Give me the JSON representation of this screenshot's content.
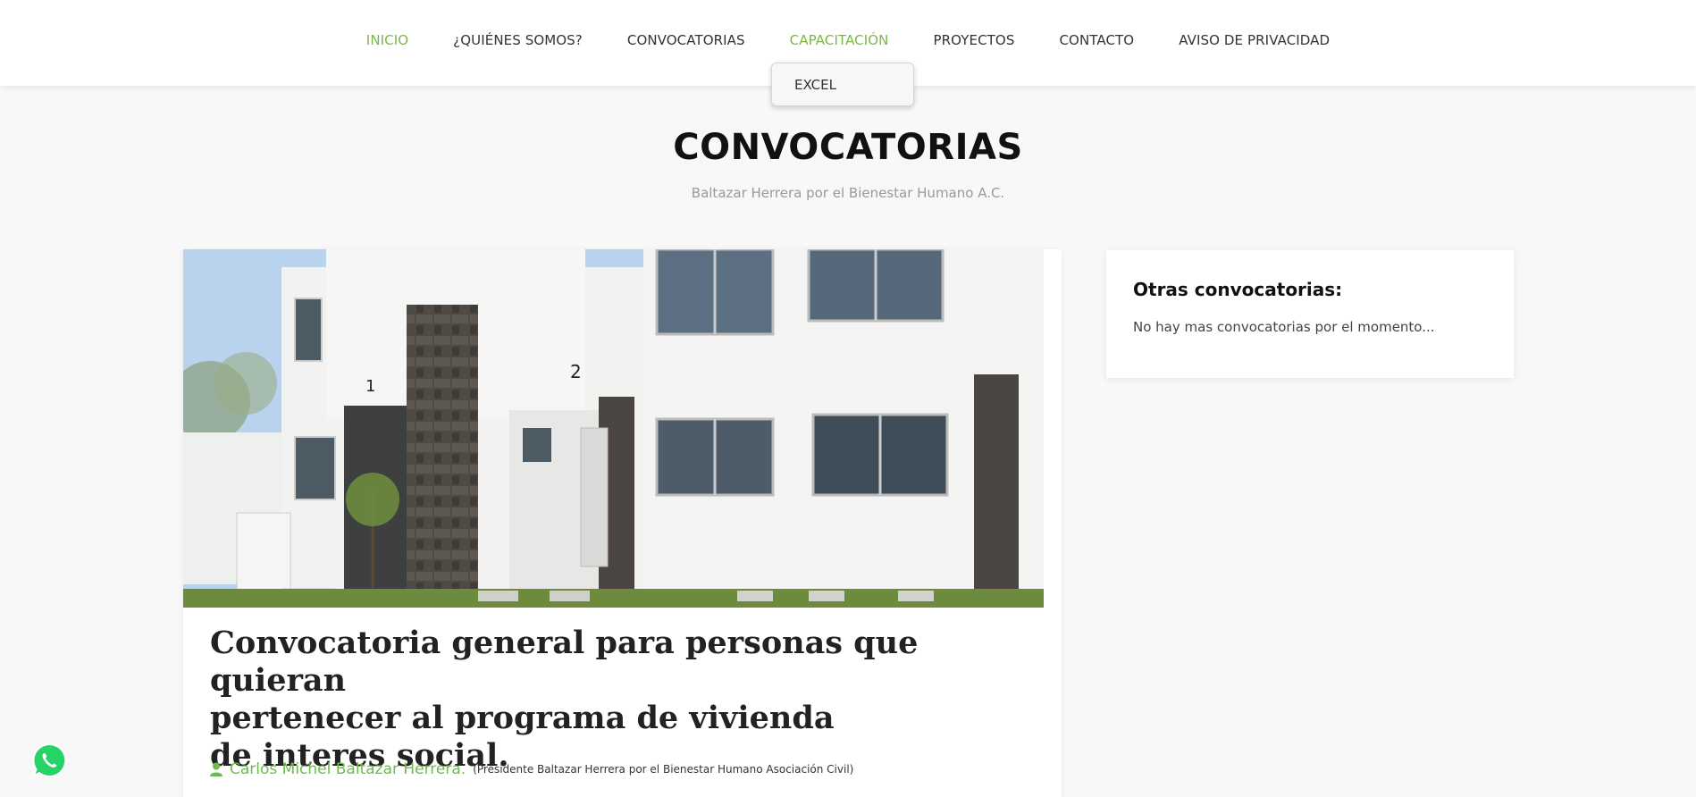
{
  "nav": {
    "items": [
      {
        "label": "INICIO"
      },
      {
        "label": "¿QUIÉNES SOMOS?"
      },
      {
        "label": "CONVOCATORIAS"
      },
      {
        "label": "CAPACITACIÓN"
      },
      {
        "label": "PROYECTOS"
      },
      {
        "label": "CONTACTO"
      },
      {
        "label": "AVISO DE PRIVACIDAD"
      }
    ],
    "dropdown": {
      "items": [
        {
          "label": "EXCEL"
        }
      ]
    }
  },
  "header": {
    "title": "CONVOCATORIAS",
    "subtitle": "Baltazar Herrera por el Bienestar Humano A.C."
  },
  "post": {
    "title_lines": [
      "Convocatoria general para personas que quieran",
      "pertenecer al programa de vivienda",
      "de interes social."
    ],
    "author_name": "Carlos Michel Baltazar Herrera.",
    "author_role": "(Presidente Baltazar Herrera por el Bienestar Humano Asociación Civil)",
    "image_house_numbers": [
      "1",
      "2"
    ]
  },
  "sidebar": {
    "title": "Otras convocatorias:",
    "text": "No hay mas convocatorias por el momento..."
  },
  "icons": {
    "author": "user-icon",
    "chat": "whatsapp-icon"
  },
  "colors": {
    "accent": "#7ab844",
    "author": "#6cbb4c",
    "whatsapp": "#25d366"
  }
}
